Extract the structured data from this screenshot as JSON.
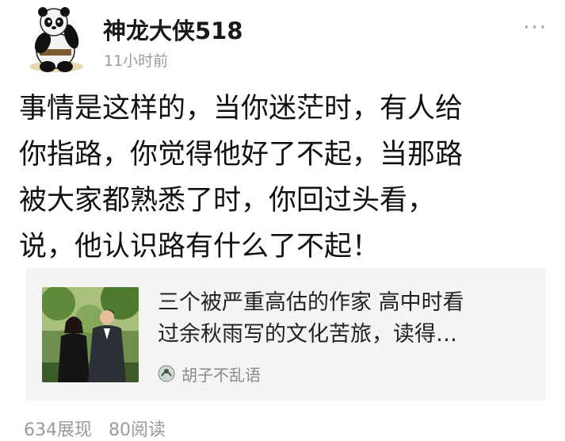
{
  "post": {
    "author_name": "神龙大侠518",
    "time": "11小时前",
    "more_icon": "more-dots-icon",
    "text_lines": [
      "事情是这样的，当你迷茫时，有人给",
      "你指路，你觉得他好了不起，当那路",
      "被大家都熟悉了时，你回过头看，",
      "说，他认识路有什么了不起！"
    ]
  },
  "linked_article": {
    "title_lines": [
      "三个被严重高估的作家  高中时看",
      "过余秋雨写的文化苦旅，读得…"
    ],
    "source_name": "胡子不乱语"
  },
  "stats": {
    "views": "634展现",
    "reads": "80阅读"
  }
}
